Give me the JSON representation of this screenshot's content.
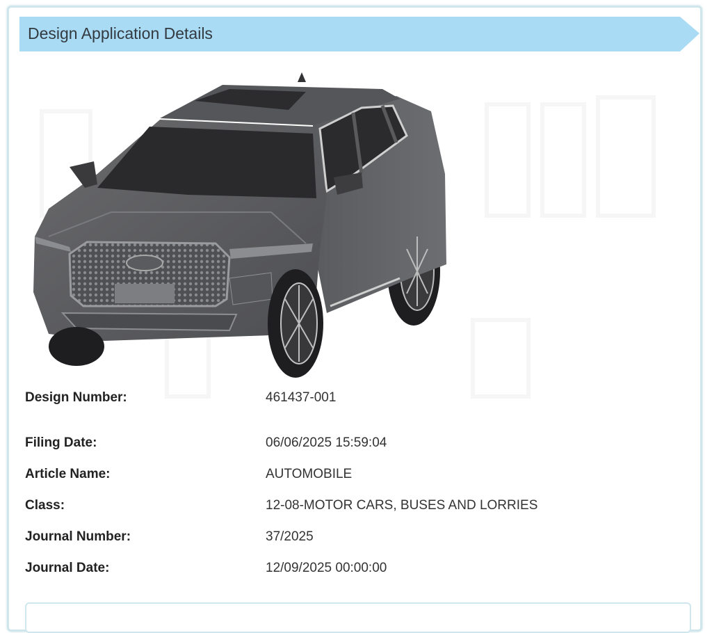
{
  "header": {
    "title": "Design Application Details",
    "banner_color": "#a9dbf5"
  },
  "image": {
    "subject": "automobile-design-drawing"
  },
  "details": [
    {
      "label": "Design Number:",
      "value": "461437-001"
    },
    {
      "label": "Filing Date:",
      "value": "06/06/2025 15:59:04"
    },
    {
      "label": "Article Name:",
      "value": "AUTOMOBILE"
    },
    {
      "label": "Class:",
      "value": "12-08-MOTOR CARS, BUSES AND LORRIES"
    },
    {
      "label": "Journal Number:",
      "value": "37/2025"
    },
    {
      "label": "Journal Date:",
      "value": "12/09/2025 00:00:00"
    }
  ]
}
